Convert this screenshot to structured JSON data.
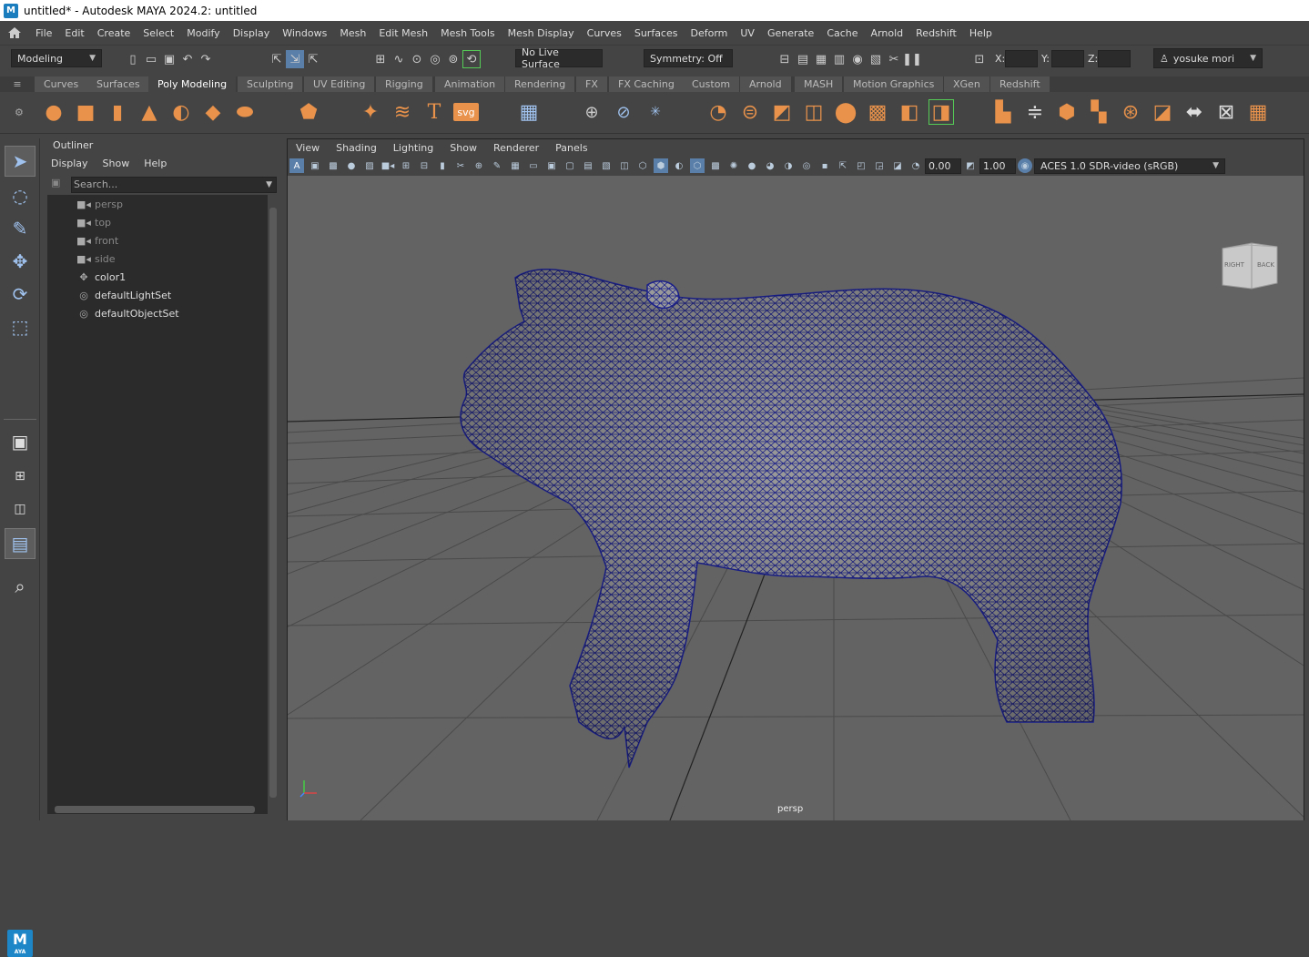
{
  "titlebar": {
    "title": "untitled* - Autodesk MAYA 2024.2: untitled",
    "icon": "maya-app-icon"
  },
  "menubar": {
    "items": [
      "File",
      "Edit",
      "Create",
      "Select",
      "Modify",
      "Display",
      "Windows",
      "Mesh",
      "Edit Mesh",
      "Mesh Tools",
      "Mesh Display",
      "Curves",
      "Surfaces",
      "Deform",
      "UV",
      "Generate",
      "Cache",
      "Arnold",
      "Redshift",
      "Help"
    ]
  },
  "statusline": {
    "mode": "Modeling",
    "live_surface": "No Live Surface",
    "symmetry": "Symmetry: Off",
    "x_label": "X:",
    "y_label": "Y:",
    "z_label": "Z:",
    "user": "yosuke mori"
  },
  "shelf": {
    "tabs": [
      "Curves",
      "Surfaces",
      "Poly Modeling",
      "Sculpting",
      "UV Editing",
      "Rigging",
      "Animation",
      "Rendering",
      "FX",
      "FX Caching",
      "Custom",
      "Arnold",
      "MASH",
      "Motion Graphics",
      "XGen",
      "Redshift"
    ],
    "active_tab": "Poly Modeling",
    "svg_label": "svg",
    "text_label": "T"
  },
  "outliner": {
    "title": "Outliner",
    "menu": [
      "Display",
      "Show",
      "Help"
    ],
    "search_placeholder": "Search...",
    "items": [
      {
        "label": "persp",
        "icon": "camera-icon",
        "dim": true
      },
      {
        "label": "top",
        "icon": "camera-icon",
        "dim": true
      },
      {
        "label": "front",
        "icon": "camera-icon",
        "dim": true
      },
      {
        "label": "side",
        "icon": "camera-icon",
        "dim": true
      },
      {
        "label": "color1",
        "icon": "transform-icon",
        "dim": false
      },
      {
        "label": "defaultLightSet",
        "icon": "set-icon",
        "dim": false
      },
      {
        "label": "defaultObjectSet",
        "icon": "set-icon",
        "dim": false
      }
    ]
  },
  "viewport": {
    "menu": [
      "View",
      "Shading",
      "Lighting",
      "Show",
      "Renderer",
      "Panels"
    ],
    "exposure": "0.00",
    "gamma": "1.00",
    "color_space": "ACES 1.0 SDR-video (sRGB)",
    "camera": "persp",
    "viewcube_right": "RIGHT",
    "viewcube_back": "BACK",
    "wire_color": "#1a1f8a"
  },
  "maya_logo": {
    "letter": "M",
    "sub": "AYA"
  }
}
